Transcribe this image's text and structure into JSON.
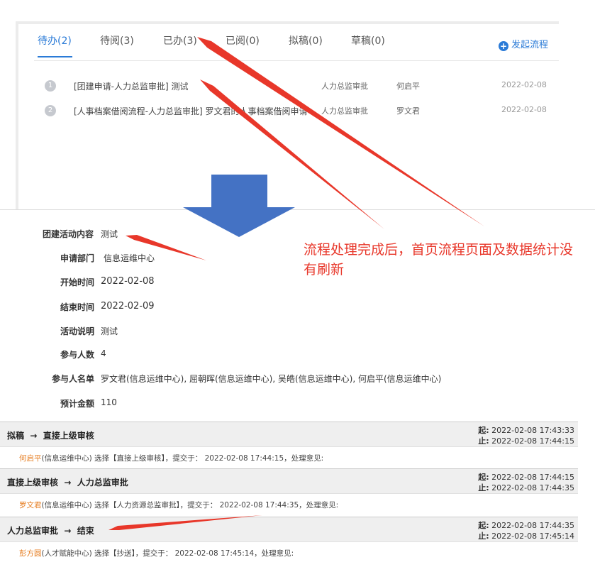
{
  "tabs": [
    {
      "label": "待办(2)",
      "active": true
    },
    {
      "label": "待阅(3)",
      "active": false
    },
    {
      "label": "已办(3)",
      "active": false
    },
    {
      "label": "已阅(0)",
      "active": false
    },
    {
      "label": "拟稿(0)",
      "active": false
    },
    {
      "label": "草稿(0)",
      "active": false
    }
  ],
  "launch_label": "发起流程",
  "launch_icon": "plus-circle-icon",
  "flow_list": [
    {
      "index": "1",
      "title": "[团建申请-人力总监审批] 测试",
      "node": "人力总监审批",
      "user": "何启平",
      "date": "2022-02-08"
    },
    {
      "index": "2",
      "title": "[人事档案借阅流程-人力总监审批] 罗文君的人事档案借阅申请",
      "node": "人力总监审批",
      "user": "罗文君",
      "date": "2022-02-08"
    }
  ],
  "form": [
    {
      "label": "团建活动内容",
      "value": "测试"
    },
    {
      "label": "申请部门",
      "value": "信息运维中心"
    },
    {
      "label": "开始时间",
      "value": "2022-02-08"
    },
    {
      "label": "结束时间",
      "value": "2022-02-09"
    },
    {
      "label": "活动说明",
      "value": "测试"
    },
    {
      "label": "参与人数",
      "value": "4"
    },
    {
      "label": "参与人名单",
      "value": "罗文君(信息运维中心), 屈朝晖(信息运维中心), 吴皓(信息运维中心), 何启平(信息运维中心)"
    },
    {
      "label": "预计金额",
      "value": "110"
    }
  ],
  "annotation": "流程处理完成后，首页流程页面及数据统计没有刷新",
  "steps": [
    {
      "from": "拟稿",
      "arrow": "→",
      "to": "直接上级审核",
      "start_label": "起:",
      "start": "2022-02-08 17:43:33",
      "end_label": "止:",
      "end": "2022-02-08 17:44:15",
      "person": "何启平",
      "detail": "(信息运维中心) 选择【直接上级审核】，提交于： 2022-02-08 17:44:15，处理意见:"
    },
    {
      "from": "直接上级审核",
      "arrow": "→",
      "to": "人力总监审批",
      "start_label": "起:",
      "start": "2022-02-08 17:44:15",
      "end_label": "止:",
      "end": "2022-02-08 17:44:35",
      "person": "罗文君",
      "detail": "(信息运维中心) 选择【人力资源总监审批】，提交于： 2022-02-08 17:44:35，处理意见:"
    },
    {
      "from": "人力总监审批",
      "arrow": "→",
      "to": "结束",
      "start_label": "起:",
      "start": "2022-02-08 17:44:35",
      "end_label": "止:",
      "end": "2022-02-08 17:45:14",
      "person": "彭方圆",
      "detail": "(人才赋能中心) 选择【抄送】，提交于： 2022-02-08 17:45:14，处理意见:"
    }
  ],
  "colors": {
    "accent": "#2b7bd7",
    "annotation_red": "#e8372a",
    "down_arrow_blue": "#4472c4",
    "person_orange": "#e67e22"
  }
}
